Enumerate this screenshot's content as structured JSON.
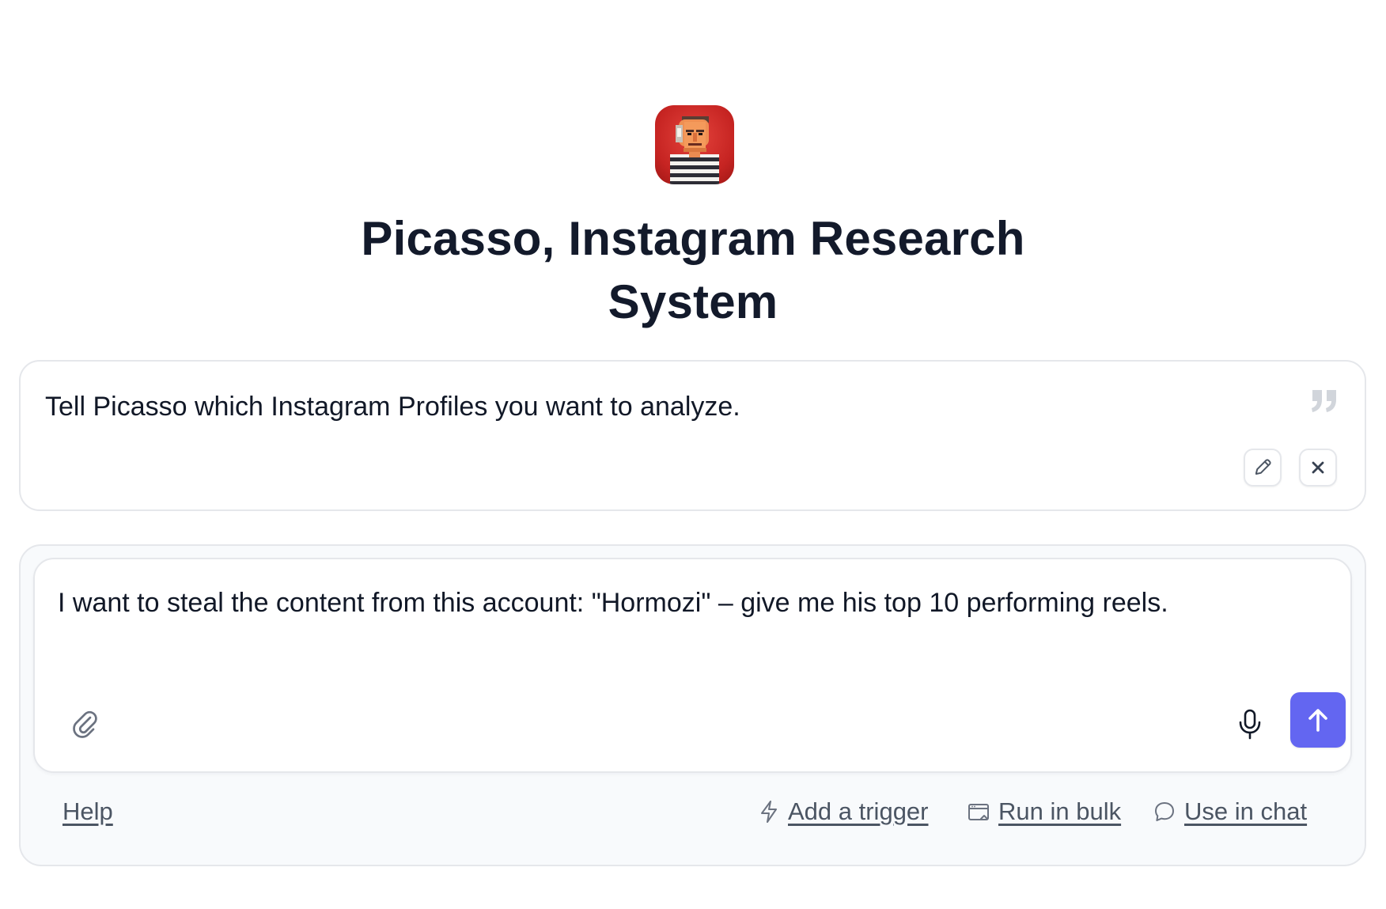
{
  "agent": {
    "name": "Picasso, Instagram Research System",
    "avatar_icon": "picasso-pixel-avatar"
  },
  "prompt_card": {
    "text": "Tell Picasso which Instagram Profiles you want to analyze.",
    "quote_icon": "quote-icon",
    "edit_icon": "pencil-icon",
    "close_icon": "close-icon"
  },
  "composer": {
    "value": "I want to steal the content from this account: \"Hormozi\" – give me his top 10 performing reels.",
    "attach_icon": "paperclip-icon",
    "mic_icon": "microphone-icon",
    "send_icon": "arrow-up-icon",
    "send_color": "#6366f1"
  },
  "footer": {
    "help_label": "Help",
    "actions": [
      {
        "label": "Add a trigger",
        "icon": "lightning-icon"
      },
      {
        "label": "Run in bulk",
        "icon": "browser-window-icon"
      },
      {
        "label": "Use in chat",
        "icon": "chat-bubble-icon"
      }
    ]
  }
}
